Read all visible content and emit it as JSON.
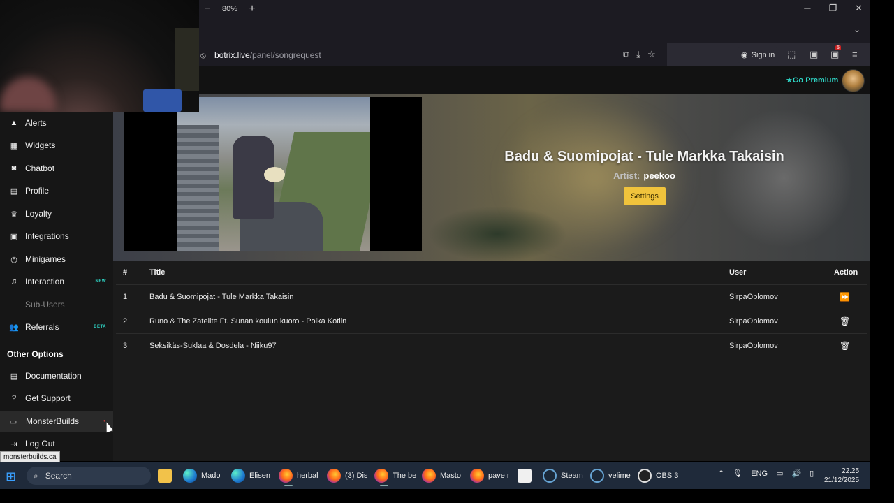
{
  "browser": {
    "zoom_level": "80%",
    "zoom_out": "−",
    "zoom_in": "+",
    "url_host": "botrix.live",
    "url_path": "/panel/songrequest",
    "sign_in": "Sign in",
    "ext_badge_1": "",
    "ext_badge_2": "5"
  },
  "header": {
    "premium": "Go Premium"
  },
  "sidebar": {
    "items": [
      {
        "label": "Alerts",
        "icon": "warning-icon"
      },
      {
        "label": "Widgets",
        "icon": "grid-icon"
      },
      {
        "label": "Chatbot",
        "icon": "robot-icon"
      },
      {
        "label": "Profile",
        "icon": "id-card-icon"
      },
      {
        "label": "Loyalty",
        "icon": "trophy-icon"
      },
      {
        "label": "Integrations",
        "icon": "plug-icon"
      },
      {
        "label": "Minigames",
        "icon": "gamepad-icon"
      },
      {
        "label": "Interaction",
        "icon": "music-icon",
        "tag": "NEW"
      },
      {
        "label": "Sub-Users",
        "icon": "users-icon"
      },
      {
        "label": "Referrals",
        "icon": "users-icon",
        "tag": "BETA"
      }
    ],
    "other_options_title": "Other Options",
    "other": [
      {
        "label": "Documentation",
        "icon": "scroll-icon"
      },
      {
        "label": "Get Support",
        "icon": "question-icon"
      },
      {
        "label": "MonsterBuilds",
        "icon": "laptop-icon"
      },
      {
        "label": "Log Out",
        "icon": "logout-icon"
      }
    ]
  },
  "now_playing": {
    "title": "Badu & Suomipojat - Tule Markka Takaisin",
    "artist_label": "Artist:",
    "artist": "peekoo",
    "settings_label": "Settings"
  },
  "queue": {
    "headers": {
      "num": "#",
      "title": "Title",
      "user": "User",
      "action": "Action"
    },
    "rows": [
      {
        "num": "1",
        "title": "Badu & Suomipojat - Tule Markka Takaisin",
        "user": "SirpaOblomov",
        "action_icon": "skip-icon"
      },
      {
        "num": "2",
        "title": "Runo & The Zatelite Ft. Sunan koulun kuoro - Poika Kotiin",
        "user": "SirpaOblomov",
        "action_icon": "trash-icon"
      },
      {
        "num": "3",
        "title": "Seksikäs-Suklaa & Dosdela - Niiku97",
        "user": "SirpaOblomov",
        "action_icon": "trash-icon"
      }
    ]
  },
  "status_url": "monsterbuilds.ca",
  "taskbar": {
    "search": "Search",
    "apps": [
      {
        "label": "Mado",
        "icon": "edge-icon"
      },
      {
        "label": "Elisen",
        "icon": "edge-icon"
      },
      {
        "label": "herbal",
        "icon": "firefox-icon"
      },
      {
        "label": "(3) Dis",
        "icon": "firefox-icon"
      },
      {
        "label": "The be",
        "icon": "firefox-icon"
      },
      {
        "label": "Masto",
        "icon": "firefox-icon"
      },
      {
        "label": "pave r",
        "icon": "firefox-icon"
      },
      {
        "label": "Steam",
        "icon": "steam-icon"
      },
      {
        "label": "velime",
        "icon": "steam-icon"
      },
      {
        "label": "OBS 3",
        "icon": "obs-icon"
      }
    ],
    "lang": "ENG",
    "time": "22.25",
    "date": "21/12/2025"
  }
}
